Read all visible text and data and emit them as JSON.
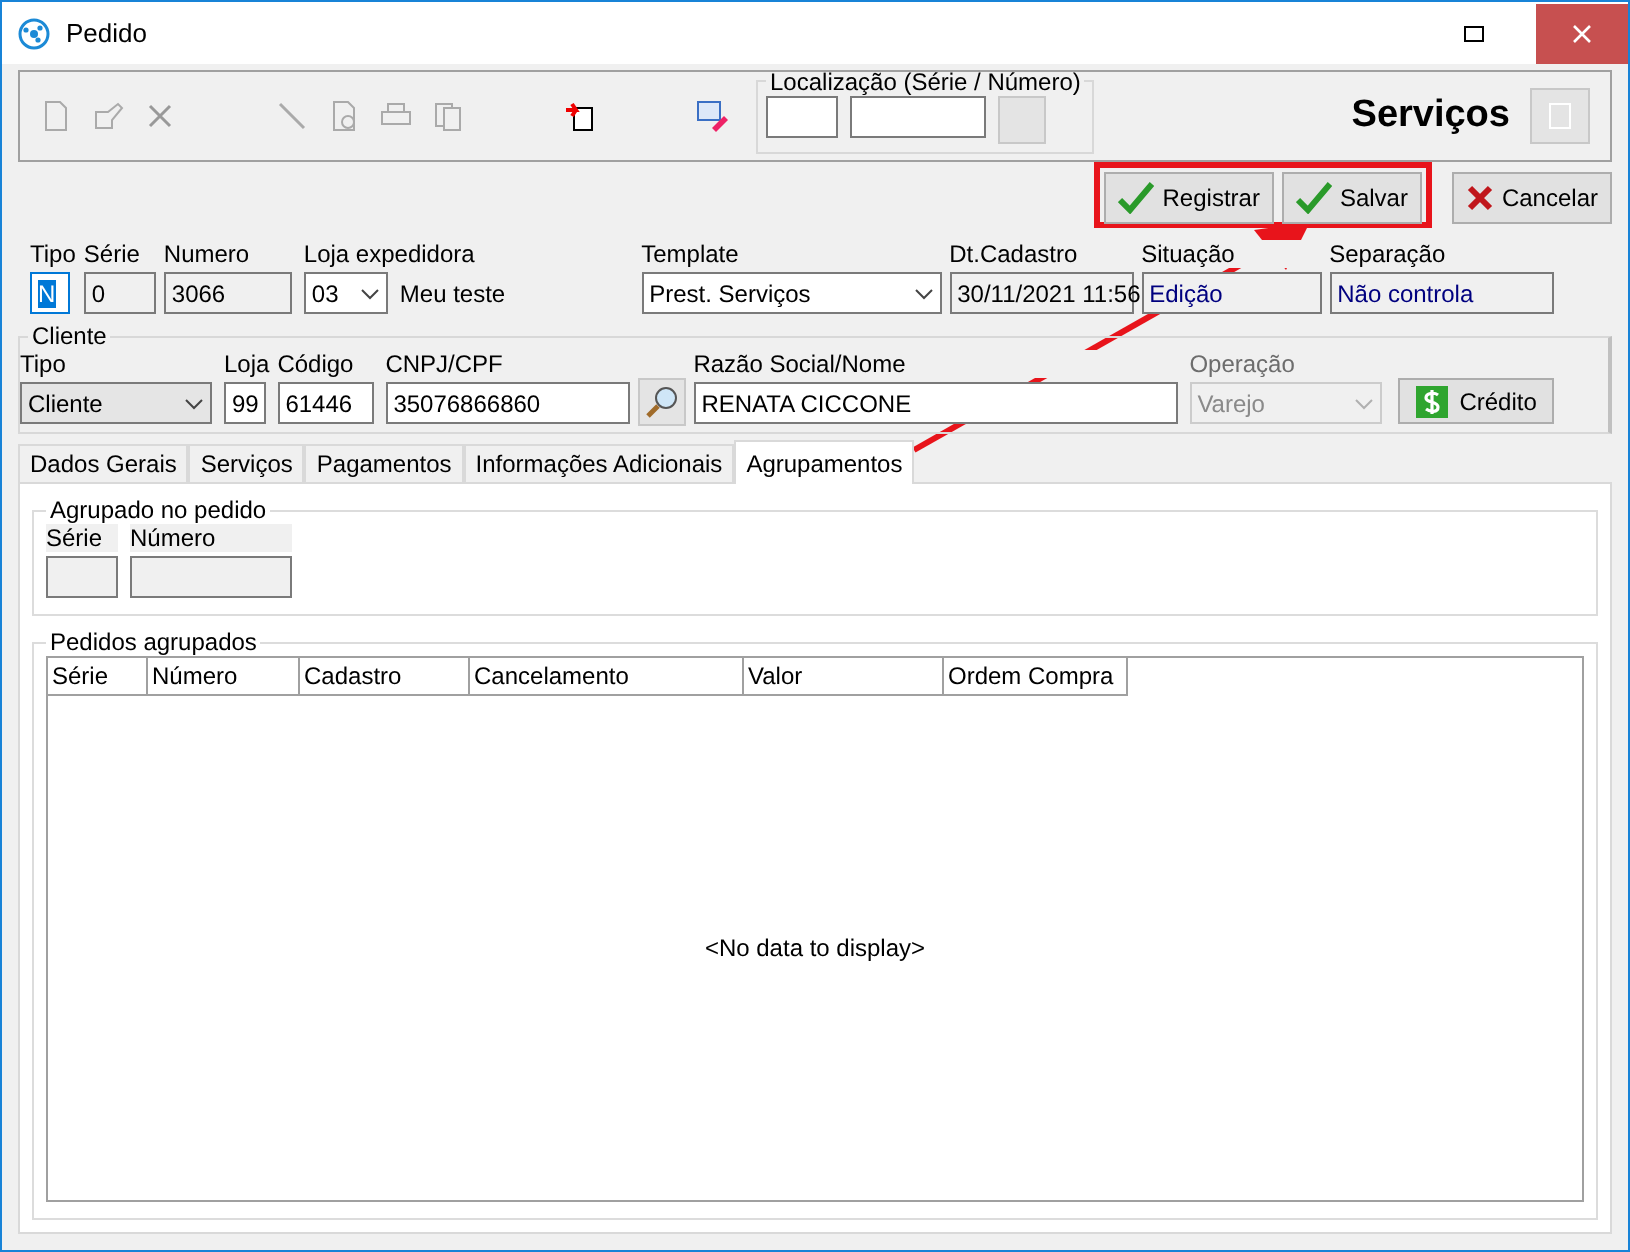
{
  "window": {
    "title": "Pedido"
  },
  "toolbar": {
    "location_label": "Localização (Série / Número)",
    "module_title": "Serviços"
  },
  "actions": [
    {
      "label": "Registrar",
      "kind": "check",
      "highlighted": true
    },
    {
      "label": "Salvar",
      "kind": "check",
      "highlighted": true
    },
    {
      "label": "Cancelar",
      "kind": "cross",
      "highlighted": false
    }
  ],
  "header": {
    "tipo": {
      "label": "Tipo",
      "value": "N",
      "focused": true
    },
    "serie": {
      "label": "Série",
      "value": "0"
    },
    "numero": {
      "label": "Numero",
      "value": "3066"
    },
    "loja": {
      "label": "Loja expedidora",
      "value": "03",
      "name": "Meu teste"
    },
    "template": {
      "label": "Template",
      "value": "Prest. Serviços"
    },
    "dt_cadastro": {
      "label": "Dt.Cadastro",
      "value": "30/11/2021 11:56"
    },
    "situacao": {
      "label": "Situação",
      "value": "Edição"
    },
    "separacao": {
      "label": "Separação",
      "value": "Não controla"
    }
  },
  "cliente": {
    "title": "Cliente",
    "tipo": {
      "label": "Tipo",
      "value": "Cliente"
    },
    "loja": {
      "label": "Loja",
      "value": "99"
    },
    "codigo": {
      "label": "Código",
      "value": "61446"
    },
    "cnpj": {
      "label": "CNPJ/CPF",
      "value": "35076866860"
    },
    "razao": {
      "label": "Razão Social/Nome",
      "value": "RENATA CICCONE"
    },
    "operacao": {
      "label": "Operação",
      "value": "Varejo",
      "disabled": true
    },
    "credito": "Crédito"
  },
  "tabs": [
    {
      "label": "Dados Gerais",
      "selected": false
    },
    {
      "label": "Serviços",
      "selected": false
    },
    {
      "label": "Pagamentos",
      "selected": false
    },
    {
      "label": "Informações Adicionais",
      "selected": false
    },
    {
      "label": "Agrupamentos",
      "selected": true
    }
  ],
  "agrupado": {
    "title": "Agrupado no pedido",
    "serie_label": "Série",
    "numero_label": "Número"
  },
  "pedidos": {
    "title": "Pedidos agrupados",
    "columns": [
      "Série",
      "Número",
      "Cadastro",
      "Cancelamento",
      "Valor",
      "Ordem Compra"
    ],
    "empty_text": "<No data to display>"
  }
}
